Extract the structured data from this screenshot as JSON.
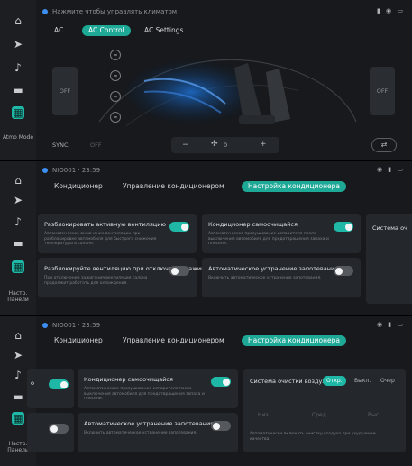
{
  "panel1": {
    "status_title": "Нажмите чтобы управлять климатом",
    "status_icons": "▮ ◉ ▭",
    "tabs": [
      "AC",
      "AC Control",
      "AC Settings"
    ],
    "active_tab": "AC Control",
    "left_temp": "OFF",
    "right_temp": "OFF",
    "sync_label": "SYNC",
    "off_label": "OFF",
    "fan_minus": "−",
    "fan_value": "0",
    "fan_plus": "+",
    "sidebar_label": "Atmo Mode"
  },
  "panel2": {
    "status_title": "NIO001 · 23:59",
    "status_icons": "◉ ▮ ▭",
    "tabs": [
      "Кондиционер",
      "Управление кондиционером",
      "Настройка кондиционера"
    ],
    "active_tab": "Настройка кондиционера",
    "sidebar_label": "Настр. Панели",
    "tiles": [
      {
        "title": "Разблокировать активную вентиляцию",
        "desc": "Автоматическое включение вентиляции при разблокировке автомобиля для быстрого снижения температуры в салоне.",
        "state": "on"
      },
      {
        "title": "Кондиционер самоочищайся",
        "desc": "Автоматическое просушивание испарителя после выключения автомобиля для предотвращения запаха и плесени.",
        "state": "on"
      },
      {
        "title": "Система оч",
        "desc": "",
        "state": "none"
      },
      {
        "title": "Разблокируйте вентиляцию при отключении зажиг.",
        "desc": "При отключении зажигания вентиляция салона продолжит работать для охлаждения.",
        "state": "off"
      },
      {
        "title": "Автоматическое устранение запотевания",
        "desc": "Включить автоматическое устранение запотевания.",
        "state": "off"
      }
    ]
  },
  "panel3": {
    "status_title": "NIO001 · 23:59",
    "status_icons": "◉ ▮ ▭",
    "tabs": [
      "Кондиционер",
      "Управление кондиционером",
      "Настройка кондиционера"
    ],
    "active_tab": "Настройка кондиционера",
    "sidebar_label": "Настр. Панели",
    "tiles": [
      {
        "title": "Кондиционер самоочищайся",
        "desc": "Автоматическое просушивание испарителя после выключения автомобиля для предотвращения запаха и плесени.",
        "state": "on"
      },
      {
        "title": "Автоматическое устранение запотевания",
        "desc": "Включить автоматическое устранение запотевания.",
        "state": "off"
      },
      {
        "title": "Система очистки воздуха",
        "desc": "Автоматически включать очистку воздуха при ухудшении качества.",
        "state": "none"
      }
    ],
    "purify_options": [
      "Откр.",
      "Выкл.",
      "Очер"
    ],
    "purify_active": "Откр.",
    "purify_levels": [
      "Низ",
      "Сред",
      "Выс"
    ],
    "partial_left_label": "o"
  },
  "colors": {
    "accent": "#1fb8a6",
    "background": "#17191c",
    "tile": "#24272b",
    "status_dot": "#3d8ef0"
  },
  "icons": [
    "home-icon",
    "navigation-icon",
    "music-icon",
    "car-icon",
    "apps-icon",
    "seat-icon",
    "fan-icon"
  ]
}
